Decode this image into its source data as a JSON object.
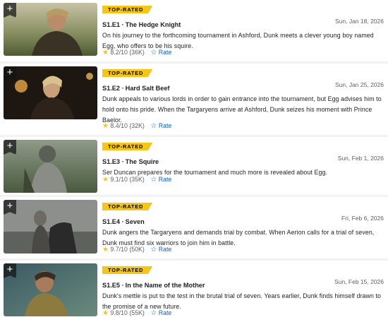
{
  "episodes": [
    {
      "badge": "TOP-RATED",
      "title": "S1.E1 ∙ The Hedge Knight",
      "date": "Sun, Jan 18, 2026",
      "description": "On his journey to the forthcoming tournament in Ashford, Dunk meets a clever young boy named Egg, who offers to be his squire.",
      "rating": "8.2/10",
      "votes": "(36K)",
      "rate_label": "Rate"
    },
    {
      "badge": "TOP-RATED",
      "title": "S1.E2 ∙ Hard Salt Beef",
      "date": "Sun, Jan 25, 2026",
      "description": "Dunk appeals to various lords in order to gain entrance into the tournament, but Egg advises him to hold onto his pride. When the Targaryens arrive at Ashford, Dunk seizes his moment with Prince Baelor.",
      "rating": "8.4/10",
      "votes": "(32K)",
      "rate_label": "Rate"
    },
    {
      "badge": "TOP-RATED",
      "title": "S1.E3 ∙ The Squire",
      "date": "Sun, Feb 1, 2026",
      "description": "Ser Duncan prepares for the tournament and much more is revealed about Egg.",
      "rating": "9.1/10",
      "votes": "(35K)",
      "rate_label": "Rate"
    },
    {
      "badge": "TOP-RATED",
      "title": "S1.E4 ∙ Seven",
      "date": "Fri, Feb 6, 2026",
      "description": "Dunk angers the Targaryens and demands trial by combat. When Aerion calls for a trial of seven, Dunk must find six warriors to join him in battle.",
      "rating": "9.7/10",
      "votes": "(50K)",
      "rate_label": "Rate"
    },
    {
      "badge": "TOP-RATED",
      "title": "S1.E5 ∙ In the Name of the Mother",
      "date": "Sun, Feb 15, 2026",
      "description": "Dunk's mettle is put to the test in the brutal trial of seven. Years earlier, Dunk finds himself drawn to the promise of a new future.",
      "rating": "9.8/10",
      "votes": "(55K)",
      "rate_label": "Rate"
    }
  ],
  "icons": {
    "add": "plus-icon",
    "star": "star-filled-icon",
    "rate": "star-outline-icon"
  },
  "colors": {
    "badge": "#f5c518",
    "star": "#f5c518",
    "link": "#0e63be",
    "background": "#f3f3f3"
  }
}
